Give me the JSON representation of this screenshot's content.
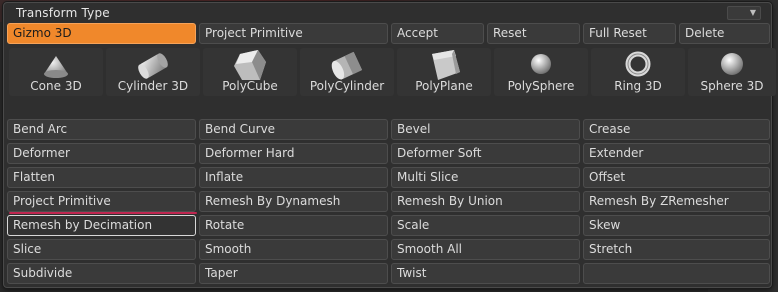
{
  "panel": {
    "title": "Transform Type"
  },
  "top_row": [
    {
      "label": "Gizmo 3D",
      "state": "active"
    },
    {
      "label": "Project Primitive",
      "state": "normal"
    },
    {
      "label": "Accept",
      "state": "normal"
    },
    {
      "label": "Reset",
      "state": "normal"
    },
    {
      "label": "Full Reset",
      "state": "normal"
    },
    {
      "label": "Delete",
      "state": "normal"
    }
  ],
  "primitives": [
    {
      "label": "Cone 3D",
      "icon": "cone-icon"
    },
    {
      "label": "Cylinder 3D",
      "icon": "cylinder-icon"
    },
    {
      "label": "PolyCube",
      "icon": "polycube-icon"
    },
    {
      "label": "PolyCylinder",
      "icon": "polycylinder-icon"
    },
    {
      "label": "PolyPlane",
      "icon": "polyplane-icon"
    },
    {
      "label": "PolySphere",
      "icon": "polysphere-icon"
    },
    {
      "label": "Ring 3D",
      "icon": "ring-icon"
    },
    {
      "label": "Sphere 3D",
      "icon": "sphere-icon"
    }
  ],
  "grid_rows": [
    [
      "Bend Arc",
      "Bend Curve",
      "Bevel",
      "Crease"
    ],
    [
      "Deformer",
      "Deformer Hard",
      "Deformer Soft",
      "Extender"
    ],
    [
      "Flatten",
      "Inflate",
      "Multi Slice",
      "Offset"
    ],
    [
      "Project Primitive",
      "Remesh By Dynamesh",
      "Remesh By Union",
      "Remesh By ZRemesher"
    ],
    [
      "Remesh by Decimation",
      "Rotate",
      "Scale",
      "Skew"
    ],
    [
      "Slice",
      "Smooth",
      "Smooth All",
      "Stretch"
    ],
    [
      "Subdivide",
      "Taper",
      "Twist",
      ""
    ]
  ],
  "selected_item": "Remesh by Decimation",
  "marked_item": "Project Primitive",
  "colors": {
    "accent": "#f0882b",
    "marker": "#c02650",
    "panel": "#2f2f2f",
    "button": "#3a3a3a"
  }
}
